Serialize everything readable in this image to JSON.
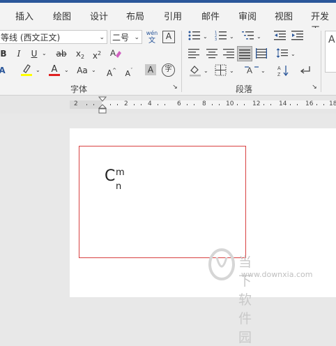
{
  "tabs": [
    "插入",
    "绘图",
    "设计",
    "布局",
    "引用",
    "邮件",
    "审阅",
    "视图",
    "开发工"
  ],
  "font": {
    "name_value": "等线 (西文正文)",
    "size_value": "二号",
    "wen_top": "wén",
    "wen_bottom": "文",
    "char_border_label": "A",
    "bold": "B",
    "italic": "I",
    "underline": "U",
    "strike": "ab",
    "subscript": "x",
    "subscript_small": "2",
    "superscript": "x",
    "superscript_small": "2",
    "font_color": "A",
    "change_case": "Aa",
    "grow": "A",
    "shrink": "A",
    "shading": "A",
    "phonetic": "字",
    "group_label": "字体"
  },
  "paragraph": {
    "group_label": "段落"
  },
  "ruler": {
    "marks": [
      "2",
      "2",
      "4",
      "6",
      "8",
      "10",
      "12",
      "14",
      "16",
      "18"
    ]
  },
  "document": {
    "formula_base": "C",
    "formula_sup": "m",
    "formula_sub": "n"
  },
  "watermark": {
    "name": "当下软件园",
    "url": "www.downxia.com"
  },
  "colors": {
    "accent": "#2b579a",
    "highlight": "#ffff00",
    "font_color": "#e02020",
    "frame": "#d84040"
  }
}
